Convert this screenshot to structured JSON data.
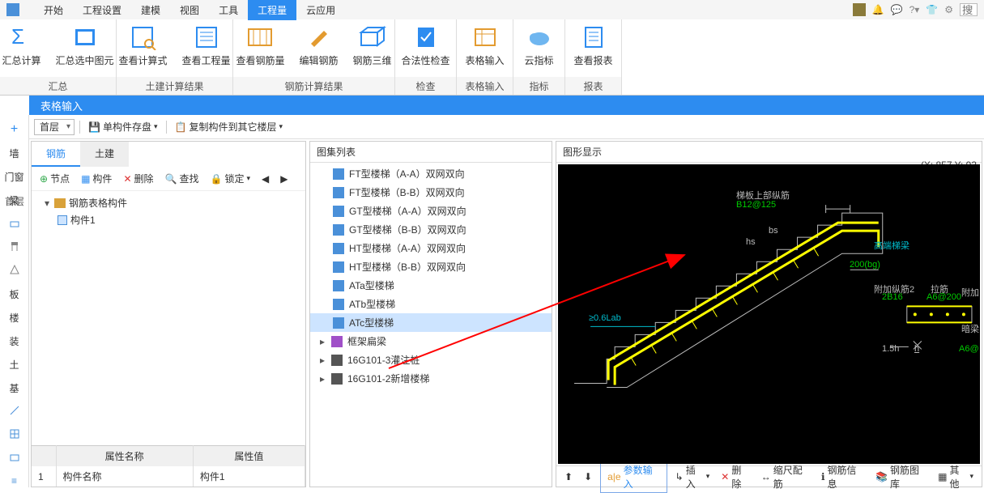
{
  "menu": {
    "items": [
      "开始",
      "工程设置",
      "建模",
      "视图",
      "工具",
      "工程量",
      "云应用"
    ],
    "active": 5,
    "search_placeholder": "搜"
  },
  "ribbon": {
    "groups": [
      {
        "label": "汇总",
        "buttons": [
          {
            "id": "sum-calc",
            "label": "汇总计算"
          },
          {
            "id": "sum-sel",
            "label": "汇总选中图元"
          }
        ]
      },
      {
        "label": "土建计算结果",
        "buttons": [
          {
            "id": "view-formula",
            "label": "查看计算式"
          },
          {
            "id": "view-qty",
            "label": "查看工程量"
          }
        ]
      },
      {
        "label": "钢筋计算结果",
        "buttons": [
          {
            "id": "view-rebar",
            "label": "查看钢筋量"
          },
          {
            "id": "edit-rebar",
            "label": "编辑钢筋"
          },
          {
            "id": "rebar-3d",
            "label": "钢筋三维"
          }
        ]
      },
      {
        "label": "检查",
        "buttons": [
          {
            "id": "valid-check",
            "label": "合法性检查"
          }
        ]
      },
      {
        "label": "表格输入",
        "buttons": [
          {
            "id": "table-input",
            "label": "表格输入"
          }
        ]
      },
      {
        "label": "指标",
        "buttons": [
          {
            "id": "cloud-idx",
            "label": "云指标"
          }
        ]
      },
      {
        "label": "报表",
        "buttons": [
          {
            "id": "view-report",
            "label": "查看报表"
          }
        ]
      }
    ]
  },
  "banner": {
    "pre": "首层",
    "title": "表格输入"
  },
  "sec_tb": {
    "floor": "首层",
    "btn1": "单构件存盘",
    "btn2": "复制构件到其它楼层"
  },
  "side": [
    "墙",
    "门窗",
    "梁",
    "",
    "",
    "",
    "板",
    "楼",
    "装",
    "土",
    "基"
  ],
  "left": {
    "tabs": [
      "钢筋",
      "土建"
    ],
    "active": 0,
    "tree_tb": [
      "节点",
      "构件",
      "删除",
      "查找",
      "锁定"
    ],
    "root": "钢筋表格构件",
    "child": "构件1",
    "prop_headers": [
      "属性名称",
      "属性值"
    ],
    "prop_row": [
      "构件名称",
      "构件1"
    ],
    "row_no": "1"
  },
  "mid": {
    "title": "图集列表",
    "items": [
      {
        "label": "FT型楼梯（A-A）双网双向"
      },
      {
        "label": "FT型楼梯（B-B）双网双向"
      },
      {
        "label": "GT型楼梯（A-A）双网双向"
      },
      {
        "label": "GT型楼梯（B-B）双网双向"
      },
      {
        "label": "HT型楼梯（A-A）双网双向"
      },
      {
        "label": "HT型楼梯（B-B）双网双向"
      },
      {
        "label": "ATa型楼梯"
      },
      {
        "label": "ATb型楼梯"
      },
      {
        "label": "ATc型楼梯",
        "selected": true
      }
    ],
    "groups": [
      {
        "label": "框架扁梁"
      },
      {
        "label": "16G101-3灌注桩"
      },
      {
        "label": "16G101-2新增楼梯"
      }
    ]
  },
  "right": {
    "title": "图形显示",
    "coord": "(X: 857 Y: 93",
    "labels": {
      "top": "梯板上部纵筋",
      "top2": "B12@125",
      "beam": "高端梯梁",
      "dim": "200(bg)",
      "add1": "附加纵筋2",
      "add1v": "2B16",
      "add2": "拉筋",
      "add2v": "A6@200",
      "add3": "附加",
      "sub": "暗梁",
      "sub2": "A6@",
      "len": "≥0.6Lab",
      "hs": "hs",
      "bs": "bs",
      "h15": "1.5h",
      "h": "h"
    }
  },
  "btm": {
    "items": [
      "参数输入",
      "插入",
      "删除",
      "缩尺配筋",
      "钢筋信息",
      "钢筋图库",
      "其他"
    ]
  }
}
